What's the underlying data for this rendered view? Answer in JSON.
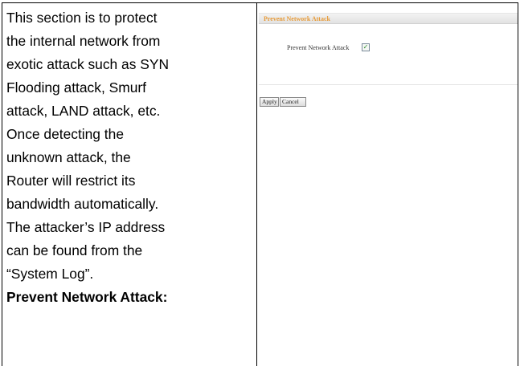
{
  "description": {
    "lines": [
      "This section is to protect",
      "the internal network from",
      "exotic attack such as SYN",
      "Flooding attack, Smurf",
      "attack, LAND attack, etc.",
      "Once detecting the",
      "unknown attack, the",
      "Router will restrict its",
      "bandwidth automatically.",
      "The attacker’s IP address",
      "can be found from the",
      "“System Log”."
    ],
    "field_heading": "Prevent Network Attack:"
  },
  "screenshot": {
    "section_title": "Prevent Network Attack",
    "field_label": "Prevent Network Attack",
    "checkbox_checked": true,
    "checkbox_glyph": "✓",
    "apply_label": "Apply",
    "cancel_label": "Cancel",
    "title_color": "#e69b3a",
    "check_color": "#2b8a2b"
  }
}
